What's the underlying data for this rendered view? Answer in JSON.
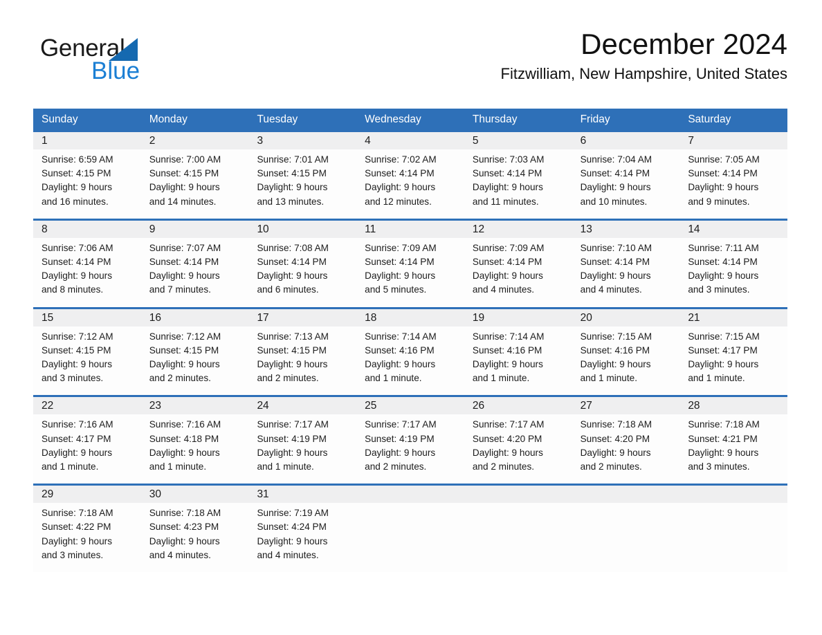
{
  "brand": {
    "name_part1": "General",
    "name_part2": "Blue",
    "logo_icon": "triangle-logo-icon",
    "blue": "#1b7fd4",
    "dark_blue": "#1569b0"
  },
  "header": {
    "month_title": "December 2024",
    "location": "Fitzwilliam, New Hampshire, United States"
  },
  "theme": {
    "header_blue": "#2e70b8",
    "daynum_band": "#efeff0",
    "text": "#1c1c1c"
  },
  "weekdays": [
    "Sunday",
    "Monday",
    "Tuesday",
    "Wednesday",
    "Thursday",
    "Friday",
    "Saturday"
  ],
  "weeks": [
    {
      "days": [
        {
          "num": "1",
          "sunrise": "Sunrise: 6:59 AM",
          "sunset": "Sunset: 4:15 PM",
          "daylight1": "Daylight: 9 hours",
          "daylight2": "and 16 minutes."
        },
        {
          "num": "2",
          "sunrise": "Sunrise: 7:00 AM",
          "sunset": "Sunset: 4:15 PM",
          "daylight1": "Daylight: 9 hours",
          "daylight2": "and 14 minutes."
        },
        {
          "num": "3",
          "sunrise": "Sunrise: 7:01 AM",
          "sunset": "Sunset: 4:15 PM",
          "daylight1": "Daylight: 9 hours",
          "daylight2": "and 13 minutes."
        },
        {
          "num": "4",
          "sunrise": "Sunrise: 7:02 AM",
          "sunset": "Sunset: 4:14 PM",
          "daylight1": "Daylight: 9 hours",
          "daylight2": "and 12 minutes."
        },
        {
          "num": "5",
          "sunrise": "Sunrise: 7:03 AM",
          "sunset": "Sunset: 4:14 PM",
          "daylight1": "Daylight: 9 hours",
          "daylight2": "and 11 minutes."
        },
        {
          "num": "6",
          "sunrise": "Sunrise: 7:04 AM",
          "sunset": "Sunset: 4:14 PM",
          "daylight1": "Daylight: 9 hours",
          "daylight2": "and 10 minutes."
        },
        {
          "num": "7",
          "sunrise": "Sunrise: 7:05 AM",
          "sunset": "Sunset: 4:14 PM",
          "daylight1": "Daylight: 9 hours",
          "daylight2": "and 9 minutes."
        }
      ]
    },
    {
      "days": [
        {
          "num": "8",
          "sunrise": "Sunrise: 7:06 AM",
          "sunset": "Sunset: 4:14 PM",
          "daylight1": "Daylight: 9 hours",
          "daylight2": "and 8 minutes."
        },
        {
          "num": "9",
          "sunrise": "Sunrise: 7:07 AM",
          "sunset": "Sunset: 4:14 PM",
          "daylight1": "Daylight: 9 hours",
          "daylight2": "and 7 minutes."
        },
        {
          "num": "10",
          "sunrise": "Sunrise: 7:08 AM",
          "sunset": "Sunset: 4:14 PM",
          "daylight1": "Daylight: 9 hours",
          "daylight2": "and 6 minutes."
        },
        {
          "num": "11",
          "sunrise": "Sunrise: 7:09 AM",
          "sunset": "Sunset: 4:14 PM",
          "daylight1": "Daylight: 9 hours",
          "daylight2": "and 5 minutes."
        },
        {
          "num": "12",
          "sunrise": "Sunrise: 7:09 AM",
          "sunset": "Sunset: 4:14 PM",
          "daylight1": "Daylight: 9 hours",
          "daylight2": "and 4 minutes."
        },
        {
          "num": "13",
          "sunrise": "Sunrise: 7:10 AM",
          "sunset": "Sunset: 4:14 PM",
          "daylight1": "Daylight: 9 hours",
          "daylight2": "and 4 minutes."
        },
        {
          "num": "14",
          "sunrise": "Sunrise: 7:11 AM",
          "sunset": "Sunset: 4:14 PM",
          "daylight1": "Daylight: 9 hours",
          "daylight2": "and 3 minutes."
        }
      ]
    },
    {
      "days": [
        {
          "num": "15",
          "sunrise": "Sunrise: 7:12 AM",
          "sunset": "Sunset: 4:15 PM",
          "daylight1": "Daylight: 9 hours",
          "daylight2": "and 3 minutes."
        },
        {
          "num": "16",
          "sunrise": "Sunrise: 7:12 AM",
          "sunset": "Sunset: 4:15 PM",
          "daylight1": "Daylight: 9 hours",
          "daylight2": "and 2 minutes."
        },
        {
          "num": "17",
          "sunrise": "Sunrise: 7:13 AM",
          "sunset": "Sunset: 4:15 PM",
          "daylight1": "Daylight: 9 hours",
          "daylight2": "and 2 minutes."
        },
        {
          "num": "18",
          "sunrise": "Sunrise: 7:14 AM",
          "sunset": "Sunset: 4:16 PM",
          "daylight1": "Daylight: 9 hours",
          "daylight2": "and 1 minute."
        },
        {
          "num": "19",
          "sunrise": "Sunrise: 7:14 AM",
          "sunset": "Sunset: 4:16 PM",
          "daylight1": "Daylight: 9 hours",
          "daylight2": "and 1 minute."
        },
        {
          "num": "20",
          "sunrise": "Sunrise: 7:15 AM",
          "sunset": "Sunset: 4:16 PM",
          "daylight1": "Daylight: 9 hours",
          "daylight2": "and 1 minute."
        },
        {
          "num": "21",
          "sunrise": "Sunrise: 7:15 AM",
          "sunset": "Sunset: 4:17 PM",
          "daylight1": "Daylight: 9 hours",
          "daylight2": "and 1 minute."
        }
      ]
    },
    {
      "days": [
        {
          "num": "22",
          "sunrise": "Sunrise: 7:16 AM",
          "sunset": "Sunset: 4:17 PM",
          "daylight1": "Daylight: 9 hours",
          "daylight2": "and 1 minute."
        },
        {
          "num": "23",
          "sunrise": "Sunrise: 7:16 AM",
          "sunset": "Sunset: 4:18 PM",
          "daylight1": "Daylight: 9 hours",
          "daylight2": "and 1 minute."
        },
        {
          "num": "24",
          "sunrise": "Sunrise: 7:17 AM",
          "sunset": "Sunset: 4:19 PM",
          "daylight1": "Daylight: 9 hours",
          "daylight2": "and 1 minute."
        },
        {
          "num": "25",
          "sunrise": "Sunrise: 7:17 AM",
          "sunset": "Sunset: 4:19 PM",
          "daylight1": "Daylight: 9 hours",
          "daylight2": "and 2 minutes."
        },
        {
          "num": "26",
          "sunrise": "Sunrise: 7:17 AM",
          "sunset": "Sunset: 4:20 PM",
          "daylight1": "Daylight: 9 hours",
          "daylight2": "and 2 minutes."
        },
        {
          "num": "27",
          "sunrise": "Sunrise: 7:18 AM",
          "sunset": "Sunset: 4:20 PM",
          "daylight1": "Daylight: 9 hours",
          "daylight2": "and 2 minutes."
        },
        {
          "num": "28",
          "sunrise": "Sunrise: 7:18 AM",
          "sunset": "Sunset: 4:21 PM",
          "daylight1": "Daylight: 9 hours",
          "daylight2": "and 3 minutes."
        }
      ]
    },
    {
      "days": [
        {
          "num": "29",
          "sunrise": "Sunrise: 7:18 AM",
          "sunset": "Sunset: 4:22 PM",
          "daylight1": "Daylight: 9 hours",
          "daylight2": "and 3 minutes."
        },
        {
          "num": "30",
          "sunrise": "Sunrise: 7:18 AM",
          "sunset": "Sunset: 4:23 PM",
          "daylight1": "Daylight: 9 hours",
          "daylight2": "and 4 minutes."
        },
        {
          "num": "31",
          "sunrise": "Sunrise: 7:19 AM",
          "sunset": "Sunset: 4:24 PM",
          "daylight1": "Daylight: 9 hours",
          "daylight2": "and 4 minutes."
        },
        {
          "num": "",
          "sunrise": "",
          "sunset": "",
          "daylight1": "",
          "daylight2": ""
        },
        {
          "num": "",
          "sunrise": "",
          "sunset": "",
          "daylight1": "",
          "daylight2": ""
        },
        {
          "num": "",
          "sunrise": "",
          "sunset": "",
          "daylight1": "",
          "daylight2": ""
        },
        {
          "num": "",
          "sunrise": "",
          "sunset": "",
          "daylight1": "",
          "daylight2": ""
        }
      ]
    }
  ]
}
